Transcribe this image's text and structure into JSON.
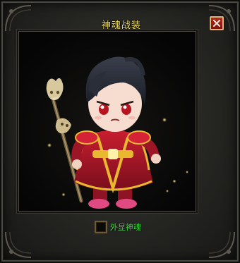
{
  "window": {
    "title": "神魂战装",
    "close_icon": "close-x-icon"
  },
  "preview": {
    "subject": "chibi-warrior-character",
    "weapon": "skull-staff"
  },
  "toggle": {
    "label": "外显神魂",
    "checked": false
  },
  "colors": {
    "title": "#f3df52",
    "toggle_label": "#36e23a",
    "close_button": "#a81e17",
    "armor_primary": "#b8192b",
    "armor_trim": "#e8b830"
  }
}
